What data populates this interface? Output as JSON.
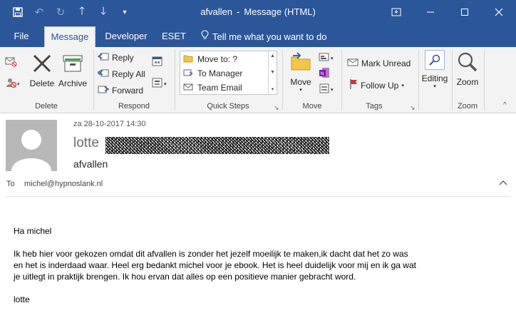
{
  "window": {
    "title_subject": "afvallen",
    "title_sep": "-",
    "title_kind": "Message (HTML)",
    "qat_icons": [
      "save-icon",
      "undo-icon",
      "redo-icon",
      "up-arrow-icon",
      "down-arrow-icon",
      "customize-icon"
    ],
    "controls": [
      "ribbon-display-icon",
      "minimize-icon",
      "maximize-icon",
      "close-icon"
    ]
  },
  "tabs": {
    "file": "File",
    "message": "Message",
    "developer": "Developer",
    "eset": "ESET",
    "tell_me": "Tell me what you want to do"
  },
  "ribbon": {
    "delete_group": {
      "label": "Delete",
      "delete_btn": "Delete",
      "archive_btn": "Archive"
    },
    "respond_group": {
      "label": "Respond",
      "reply": "Reply",
      "reply_all": "Reply All",
      "forward": "Forward"
    },
    "quick_steps": {
      "label": "Quick Steps",
      "items": [
        "Move to: ?",
        "To Manager",
        "Team Email"
      ]
    },
    "move_group": {
      "label": "Move",
      "move_btn": "Move"
    },
    "tags_group": {
      "label": "Tags",
      "mark_unread": "Mark Unread",
      "follow_up": "Follow Up"
    },
    "editing_group": {
      "label": "",
      "editing_btn": "Editing"
    },
    "zoom_group": {
      "label": "Zoom",
      "zoom_btn": "Zoom"
    }
  },
  "message": {
    "date": "za 28-10-2017 14:30",
    "sender_name": "lotte",
    "subject": "afvallen",
    "to_label": "To",
    "to_value": "michel@hypnoslank.nl",
    "body": {
      "greeting": "Ha michel",
      "paragraph_lines": [
        "Ik heb hier voor gekozen omdat dit afvallen is zonder het jezelf moeilijk te maken,ik dacht dat het zo was",
        "en het is inderdaad waar. Heel erg bedankt michel voor je ebook. Het is heel duidelijk voor mij en ik ga wat",
        "je uitlegt in praktijk brengen. Ik hou ervan dat alles op een positieve manier gebracht word."
      ],
      "signature": "lotte"
    }
  },
  "colors": {
    "accent": "#2b579a",
    "ribbon_bg": "#f3f3f3"
  }
}
